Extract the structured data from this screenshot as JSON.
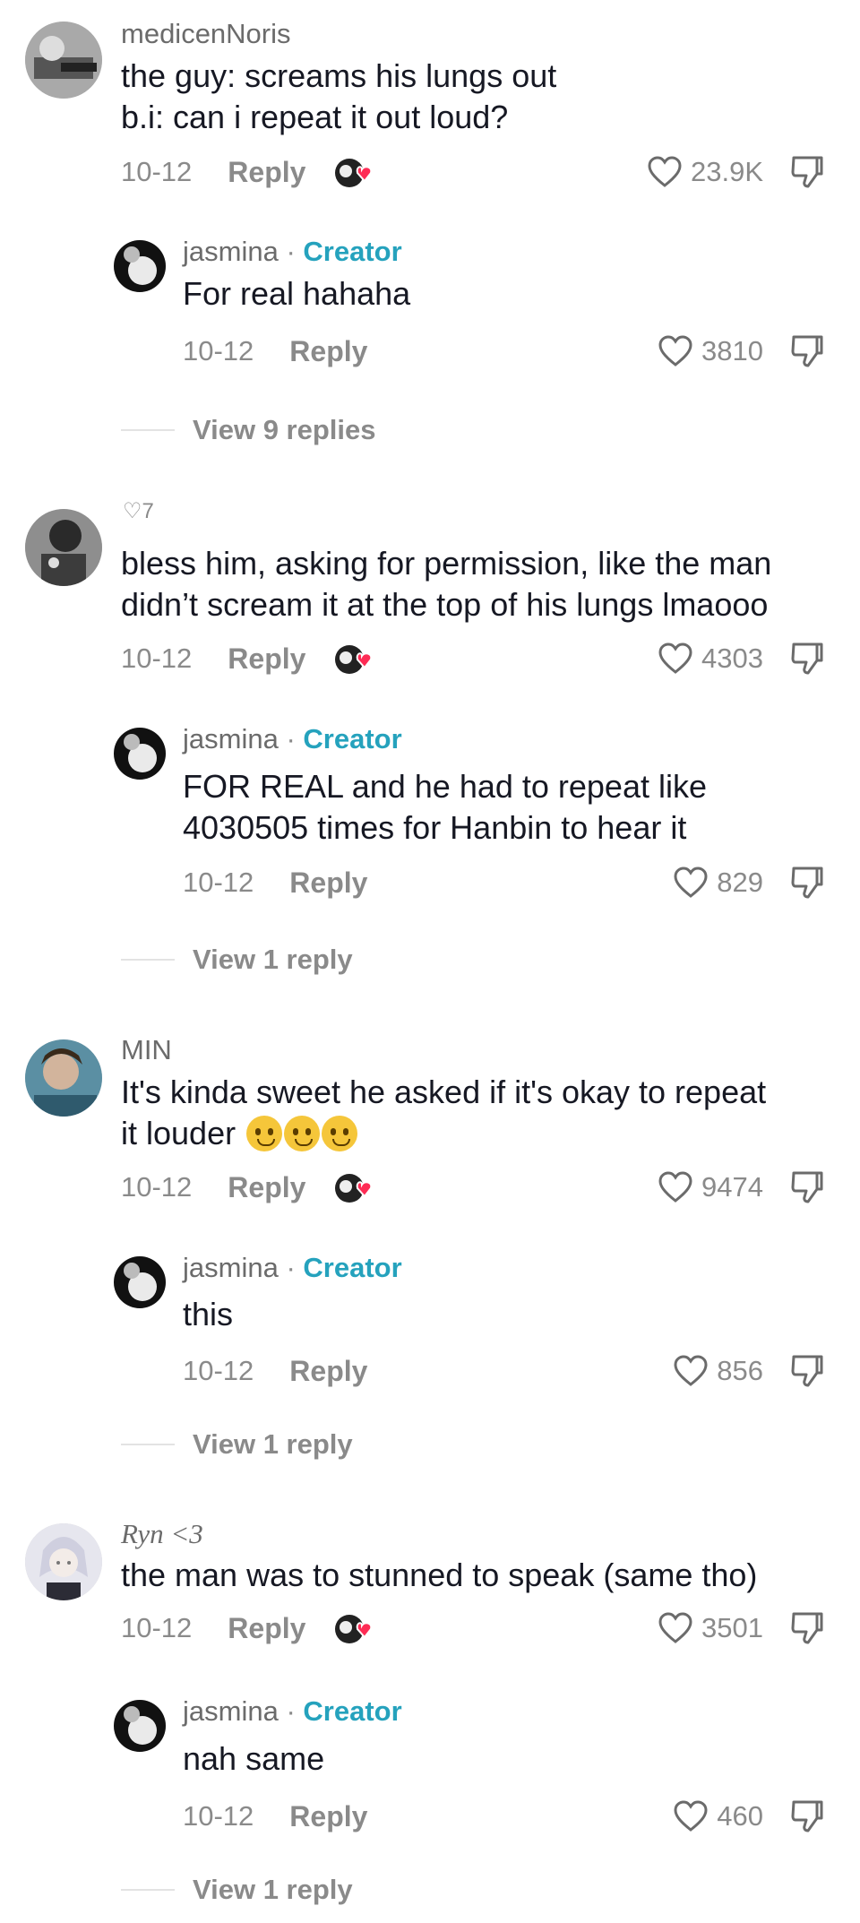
{
  "comments": [
    {
      "username": "medicenNoris",
      "text_lines": [
        "the guy: screams his lungs out",
        "b.i: can i repeat it out loud?"
      ],
      "date": "10-12",
      "reply_label": "Reply",
      "likes": "23.9K",
      "creator_reply": {
        "username": "jasmina",
        "separator": " · ",
        "badge": "Creator",
        "text_lines": [
          "For real hahaha"
        ],
        "date": "10-12",
        "reply_label": "Reply",
        "likes": "3810"
      },
      "view_replies": "View 9 replies"
    },
    {
      "username": "",
      "pin_count": "7",
      "text_lines": [
        "bless him, asking for permission, like the man",
        "didn’t scream it at the top of his lungs lmaooo"
      ],
      "date": "10-12",
      "reply_label": "Reply",
      "likes": "4303",
      "creator_reply": {
        "username": "jasmina",
        "separator": " · ",
        "badge": "Creator",
        "text_lines": [
          "FOR REAL and he had to repeat like",
          "4030505 times for Hanbin to hear it"
        ],
        "date": "10-12",
        "reply_label": "Reply",
        "likes": "829"
      },
      "view_replies": "View 1 reply"
    },
    {
      "username": "MIN",
      "text_lines": [
        "It's kinda sweet he asked if it's okay to repeat",
        "it louder"
      ],
      "date": "10-12",
      "reply_label": "Reply",
      "likes": "9474",
      "creator_reply": {
        "username": "jasmina",
        "separator": " · ",
        "badge": "Creator",
        "text_lines": [
          "this"
        ],
        "date": "10-12",
        "reply_label": "Reply",
        "likes": "856"
      },
      "view_replies": "View 1 reply"
    },
    {
      "username": "Ryn <3",
      "text_lines": [
        "the man was to stunned to speak (same tho)"
      ],
      "date": "10-12",
      "reply_label": "Reply",
      "likes": "3501",
      "creator_reply": {
        "username": "jasmina",
        "separator": " · ",
        "badge": "Creator",
        "text_lines": [
          "nah same"
        ],
        "date": "10-12",
        "reply_label": "Reply",
        "likes": "460"
      },
      "view_replies": "View 1 reply"
    }
  ],
  "colors": {
    "creator": "#25a2bd",
    "muted": "#8a8a8a",
    "text": "#161823",
    "heart_badge": "#fe2c55"
  },
  "icons": {
    "like": "heart-outline-icon",
    "dislike": "thumbs-down-icon",
    "creator_liked": "creator-liked-badge-icon",
    "pinned": "heart-pin-icon"
  }
}
